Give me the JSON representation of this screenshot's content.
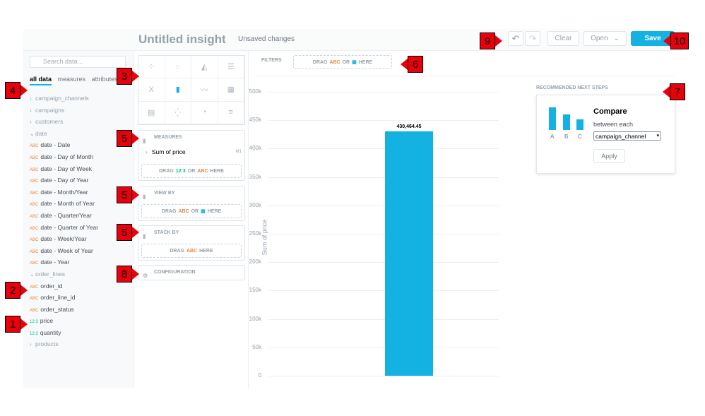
{
  "header": {
    "title": "Untitled insight",
    "unsaved": "Unsaved changes",
    "undo_icon": "↶",
    "redo_icon": "↷",
    "clear_label": "Clear",
    "open_label": "Open",
    "open_caret": "⌄",
    "save_label": "Save"
  },
  "sidebar": {
    "search_placeholder": "Search data...",
    "tabs": [
      "all data",
      "measures",
      "attributes"
    ],
    "items": [
      {
        "type": "group",
        "label": "campaign_channels",
        "open": false
      },
      {
        "type": "group",
        "label": "campaigns",
        "open": false
      },
      {
        "type": "group",
        "label": "customers",
        "open": false
      },
      {
        "type": "group",
        "label": "date",
        "open": true
      },
      {
        "type": "attr",
        "label": "date - Date"
      },
      {
        "type": "attr",
        "label": "date - Day of Month"
      },
      {
        "type": "attr",
        "label": "date - Day of Week"
      },
      {
        "type": "attr",
        "label": "date - Day of Year"
      },
      {
        "type": "attr",
        "label": "date - Month/Year"
      },
      {
        "type": "attr",
        "label": "date - Month of Year"
      },
      {
        "type": "attr",
        "label": "date - Quarter/Year"
      },
      {
        "type": "attr",
        "label": "date - Quarter of Year"
      },
      {
        "type": "attr",
        "label": "date - Week/Year"
      },
      {
        "type": "attr",
        "label": "date - Week of Year"
      },
      {
        "type": "attr",
        "label": "date - Year"
      },
      {
        "type": "group",
        "label": "order_lines",
        "open": true
      },
      {
        "type": "attr",
        "label": "order_id"
      },
      {
        "type": "attr",
        "label": "order_line_id"
      },
      {
        "type": "attr",
        "label": "order_status"
      },
      {
        "type": "fact",
        "label": "price"
      },
      {
        "type": "fact",
        "label": "quantity"
      },
      {
        "type": "group",
        "label": "products",
        "open": false
      }
    ],
    "abc": "ABC",
    "num": "12:3"
  },
  "panel": {
    "measures_title": "MEASURES",
    "measure_item": "Sum of price",
    "measure_tag": "M1",
    "measures_drop": {
      "pre": "DRAG",
      "num": "12:3",
      "or": "OR",
      "abc": "ABC",
      "post": "HERE"
    },
    "viewby_title": "VIEW BY",
    "viewby_drop": {
      "pre": "DRAG",
      "abc": "ABC",
      "or": "OR",
      "cal": "▦",
      "post": "HERE"
    },
    "stackby_title": "STACK BY",
    "stackby_drop": {
      "pre": "DRAG",
      "abc": "ABC",
      "post": "HERE"
    },
    "config_title": "CONFIGURATION"
  },
  "filters": {
    "label": "FILTERS",
    "drop": {
      "pre": "DRAG",
      "abc": "ABC",
      "or": "OR",
      "cal": "▦",
      "post": "HERE"
    }
  },
  "recommendation": {
    "title": "RECOMMENDED NEXT STEPS",
    "card_title": "Compare",
    "card_sub": "between each",
    "select_value": "campaign_channel",
    "apply_label": "Apply",
    "bar_labels": [
      "A",
      "B",
      "C"
    ]
  },
  "markers": [
    "1",
    "2",
    "3",
    "4",
    "5",
    "5",
    "5",
    "6",
    "7",
    "8",
    "9",
    "10"
  ],
  "chart_data": {
    "type": "bar",
    "ylabel": "Sum of price",
    "ylim": [
      0,
      500000
    ],
    "yticks": [
      "0",
      "50k",
      "100k",
      "150k",
      "200k",
      "250k",
      "300k",
      "350k",
      "400k",
      "450k",
      "500k"
    ],
    "series": [
      {
        "values": [
          430464.45
        ]
      }
    ],
    "data_labels": [
      "430,464.45"
    ],
    "color": "#14b2e2"
  }
}
